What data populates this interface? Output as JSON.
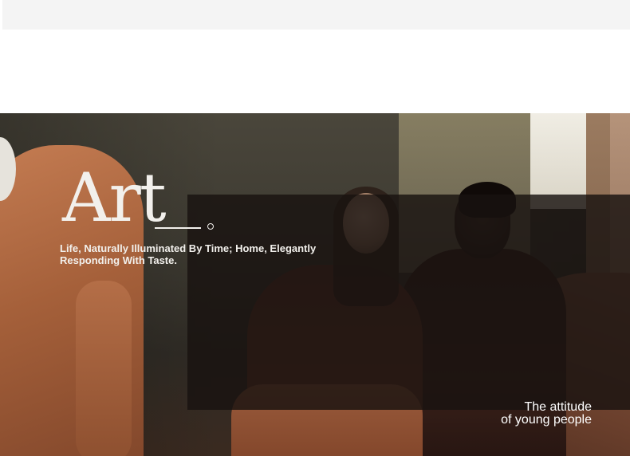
{
  "hero": {
    "brand_word": "Art",
    "tagline": "Life, Naturally Illuminated By Time; Home, Elegantly Responding With Taste.",
    "caption_line1": "The attitude",
    "caption_line2": "of young people"
  },
  "colors": {
    "topbar": "#f4f4f4",
    "overlay": "#181210",
    "text": "#f2f0ec"
  }
}
